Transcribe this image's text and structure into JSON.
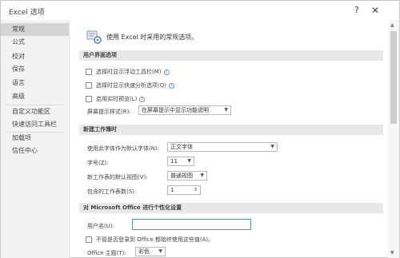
{
  "window": {
    "title": "Excel 选项",
    "help_glyph": "?",
    "close_glyph": "✕"
  },
  "sidebar": {
    "items": [
      {
        "label": "常规"
      },
      {
        "label": "公式"
      },
      {
        "label": "校对"
      },
      {
        "label": "保存"
      },
      {
        "label": "语言"
      },
      {
        "label": "高级"
      },
      {
        "label": "自定义功能区"
      },
      {
        "label": "快速访问工具栏"
      },
      {
        "label": "加载项"
      },
      {
        "label": "信任中心"
      }
    ],
    "active": "常规"
  },
  "intro": {
    "text": "使用 Excel 时采用的常规选项。"
  },
  "ui_options": {
    "header": "用户界面选项",
    "checkboxes": [
      {
        "label": "选择时显示浮动工具栏(M)",
        "checked": false
      },
      {
        "label": "选择时显示快速分析选项(Q)",
        "checked": false
      },
      {
        "label": "启用实时预览(L)",
        "checked": false
      }
    ],
    "screentip_label": "屏幕提示样式(R):",
    "screentip_value": "在屏幕提示中显示功能说明"
  },
  "new_workbook": {
    "header": "新建工作簿时",
    "font_label": "使用此字体作为默认字体(N):",
    "font_value": "正文字体",
    "size_label": "字号(Z):",
    "size_value": "11",
    "view_label": "新工作表的默认视图(V):",
    "view_value": "普通视图",
    "sheets_label": "包含的工作表数(S):",
    "sheets_value": "1"
  },
  "personalize": {
    "header": "对 Microsoft Office 进行个性化设置",
    "username_label": "用户名(U):",
    "username_value": "",
    "always_use_label": "不管是否登录到 Office 都始终使用这些值(A)。",
    "theme_label": "Office 主题(T):",
    "theme_value": "彩色"
  },
  "icons": {
    "info": "i",
    "caret": "▼",
    "spin": "⇕",
    "scroll_up": "▲",
    "scroll_down": "▼"
  },
  "colors": {
    "active_nav": "#d5d5d5",
    "section_header": "#e8e8e8",
    "input_border": "#4f9c88"
  }
}
